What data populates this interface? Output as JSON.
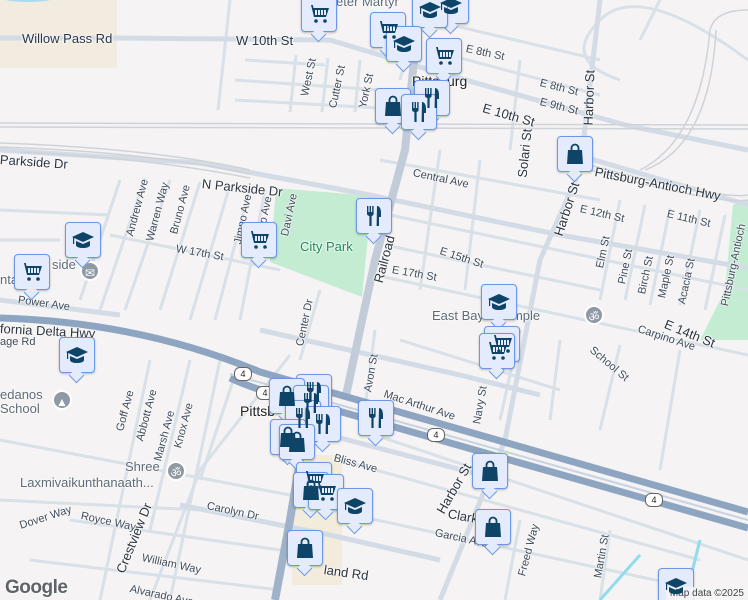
{
  "map": {
    "city_label": "Pittsburg",
    "city_label_2": "Pittsb",
    "park_label": "City Park",
    "streets": {
      "willow_pass": "Willow Pass Rd",
      "w10": "W 10th St",
      "e10": "E 10th St",
      "e8a": "E 8th St",
      "e8b": "E 8th St",
      "e9": "E 9th St",
      "harbor1": "Harbor St",
      "harbor2": "Harbor St",
      "harbor3": "Harbor St",
      "solari": "Solari St",
      "central": "Central Ave",
      "pah": "Pittsburg-Antioch Hwy",
      "pah2": "Pittsburg-Antioch",
      "e12": "E 12th St",
      "e11": "E 11th St",
      "e15": "E 15th St",
      "e17": "E 17th St",
      "e14": "E 14th St",
      "railroad": "Railroad",
      "west": "West St",
      "cutter": "Cutter St",
      "york": "York St",
      "parkside": "Parkside Dr",
      "nparkside": "N Parkside Dr",
      "andrew": "Andrew Ave",
      "warren": "Warren Way",
      "bruno": "Bruno Ave",
      "jimno": "Jimno Ave",
      "lio": "lio Ave",
      "davi": "Davi Ave",
      "w17": "W 17th St",
      "elm": "Elm St",
      "pine": "Pine St",
      "birch": "Birch St",
      "maple": "Maple St",
      "acacia": "Acacia St",
      "power": "Power Ave",
      "cadelta": "fornia Delta Hwy",
      "age": "age Rd",
      "center": "Center Dr",
      "avon": "Avon St",
      "carpino": "Carpino Ave",
      "school": "School St",
      "macarthur": "Mac Arthur Ave",
      "navy": "Navy St",
      "goff": "Goff Ave",
      "abbott": "Abbott Ave",
      "marsh": "Marsh Ave",
      "knox": "Knox Ave",
      "bliss": "Bliss Ave",
      "carolyn": "Carolyn Dr",
      "dover": "Dover Way",
      "royce": "Royce Way",
      "crestview": "Crestview Dr",
      "william": "William Way",
      "alvarado": "Alvarado Ave",
      "land": "land Rd",
      "clark": "Clark",
      "garcia": "Garcia Ave",
      "freed": "Freed Way",
      "martin": "Martin St"
    },
    "pois": {
      "peter": "eter Martyr",
      "parkside_school_1": "side",
      "parkside_school_2": "nta  hool",
      "medanos_1": "edanos",
      "medanos_2": "School",
      "shree_1": "Shree",
      "shree_2": "Laxmivaikunthanaath...",
      "temple": "East Bay    u Temple"
    },
    "highway_shield": "4",
    "logo": "Google",
    "attribution": "Map data ©2025"
  },
  "colors": {
    "pin_bg": "#e3ebfc",
    "pin_border": "#6a97e6",
    "pin_icon": "#0d4468",
    "highway": "#8ea5c2",
    "park": "#c3ecd2"
  }
}
